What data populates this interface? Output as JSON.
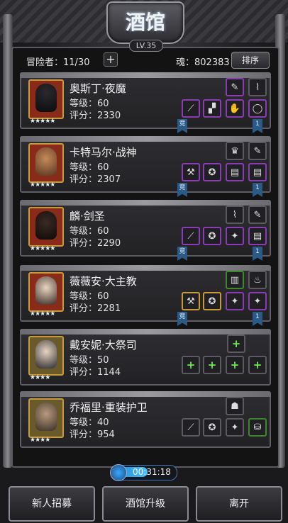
{
  "header": {
    "title": "酒馆",
    "level": "LV.35",
    "adventurers_label": "冒险者：11/30",
    "add_label": "+",
    "souls_label": "魂：802383",
    "sort_label": "排序"
  },
  "heroes": [
    {
      "name": "奥斯丁·夜魔",
      "level": "等级：60",
      "score": "评分：2330",
      "stars": "★★★★★",
      "ribbon_left": "竞",
      "ribbon_right": "1"
    },
    {
      "name": "卡特马尔·战神",
      "level": "等级：60",
      "score": "评分：2307",
      "stars": "★★★★★",
      "ribbon_left": "竞",
      "ribbon_right": "1"
    },
    {
      "name": "麟·剑圣",
      "level": "等级：60",
      "score": "评分：2290",
      "stars": "★★★★★",
      "ribbon_left": "竞",
      "ribbon_right": "1"
    },
    {
      "name": "薇薇安·大主教",
      "level": "等级：60",
      "score": "评分：2281",
      "stars": "★★★★★",
      "ribbon_left": "竞",
      "ribbon_right": "1"
    },
    {
      "name": "戴安妮·大祭司",
      "level": "等级：50",
      "score": "评分：1144",
      "stars": "★★★★",
      "ribbon_left": "",
      "ribbon_right": ""
    },
    {
      "name": "乔福里·重装护卫",
      "level": "等级：40",
      "score": "评分：954",
      "stars": "★★★★",
      "ribbon_left": "",
      "ribbon_right": ""
    }
  ],
  "timer": {
    "text": "00:31:18",
    "progress": 0.55
  },
  "footer": {
    "recruit": "新人招募",
    "upgrade": "酒馆升级",
    "leave": "离开"
  },
  "colors": {
    "slot_purple": "#8b3bb5",
    "slot_gold": "#c79a3a",
    "ribbon_blue": "#2b5a86",
    "timer_blue": "#48c0ff"
  }
}
